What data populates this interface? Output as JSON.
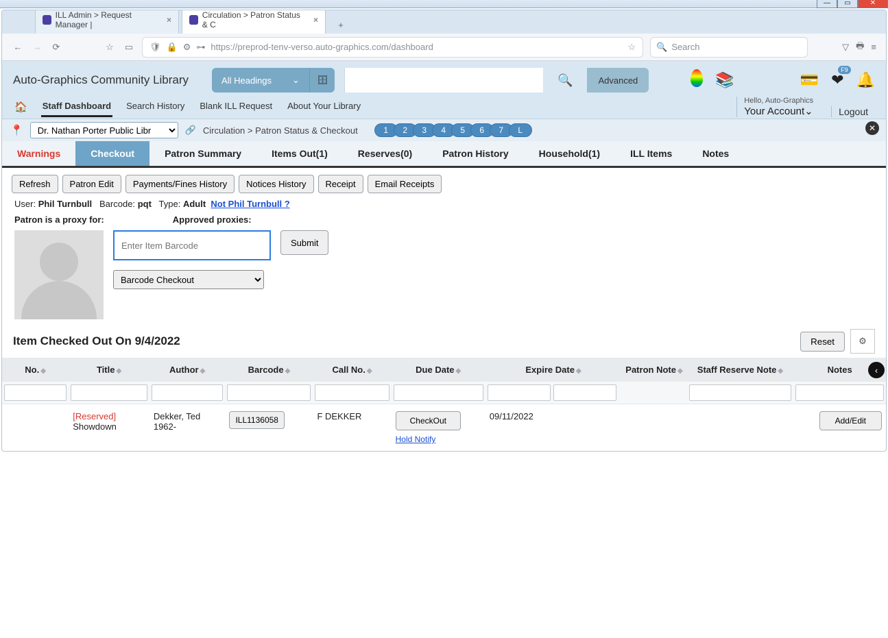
{
  "browser": {
    "tabs": [
      {
        "title": "ILL Admin > Request Manager |"
      },
      {
        "title": "Circulation > Patron Status & C"
      }
    ],
    "url": "https://preprod-tenv-verso.auto-graphics.com/dashboard",
    "search_placeholder": "Search"
  },
  "header": {
    "brand": "Auto-Graphics Community Library",
    "headings": "All Headings",
    "advanced": "Advanced",
    "hello": "Hello, Auto-Graphics",
    "account": "Your Account",
    "logout": "Logout",
    "f9": "F9"
  },
  "nav": {
    "items": [
      "Staff Dashboard",
      "Search History",
      "Blank ILL Request",
      "About Your Library"
    ]
  },
  "location": {
    "library": "Dr. Nathan Porter Public Libr",
    "breadcrumb": "Circulation  >  Patron Status & Checkout",
    "pills": [
      "1",
      "2",
      "3",
      "4",
      "5",
      "6",
      "7",
      "L"
    ]
  },
  "subtabs": [
    "Warnings",
    "Checkout",
    "Patron Summary",
    "Items Out(1)",
    "Reserves(0)",
    "Patron History",
    "Household(1)",
    "ILL Items",
    "Notes"
  ],
  "actions": [
    "Refresh",
    "Patron Edit",
    "Payments/Fines History",
    "Notices History",
    "Receipt",
    "Email Receipts"
  ],
  "user": {
    "label_user": "User:",
    "name": "Phil Turnbull",
    "label_barcode": "Barcode:",
    "barcode": "pqt",
    "label_type": "Type:",
    "type": "Adult",
    "not_link": "Not Phil Turnbull ?"
  },
  "proxy": {
    "for_label": "Patron is a proxy for:",
    "approved_label": "Approved proxies:"
  },
  "form": {
    "barcode_placeholder": "Enter Item Barcode",
    "submit": "Submit",
    "mode": "Barcode Checkout"
  },
  "section": {
    "title": "Item Checked Out On 9/4/2022",
    "reset": "Reset"
  },
  "table": {
    "cols": [
      "No.",
      "Title",
      "Author",
      "Barcode",
      "Call No.",
      "Due Date",
      "Expire Date",
      "Patron Note",
      "Staff Reserve Note",
      "Notes"
    ],
    "row": {
      "reserved": "[Reserved]",
      "title": "Showdown",
      "author": "Dekker, Ted 1962-",
      "barcode_btn": "ILL1136058",
      "callno": "F DEKKER",
      "due_btn": "CheckOut",
      "hold_notify": "Hold Notify",
      "expire": "09/11/2022",
      "addedit": "Add/Edit"
    }
  }
}
